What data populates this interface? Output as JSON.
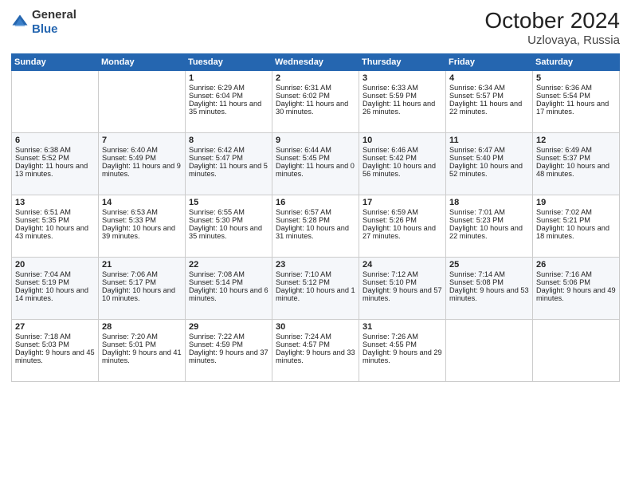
{
  "header": {
    "logo_general": "General",
    "logo_blue": "Blue",
    "month": "October 2024",
    "location": "Uzlovaya, Russia"
  },
  "days_of_week": [
    "Sunday",
    "Monday",
    "Tuesday",
    "Wednesday",
    "Thursday",
    "Friday",
    "Saturday"
  ],
  "weeks": [
    [
      {
        "day": "",
        "sunrise": "",
        "sunset": "",
        "daylight": ""
      },
      {
        "day": "",
        "sunrise": "",
        "sunset": "",
        "daylight": ""
      },
      {
        "day": "1",
        "sunrise": "Sunrise: 6:29 AM",
        "sunset": "Sunset: 6:04 PM",
        "daylight": "Daylight: 11 hours and 35 minutes."
      },
      {
        "day": "2",
        "sunrise": "Sunrise: 6:31 AM",
        "sunset": "Sunset: 6:02 PM",
        "daylight": "Daylight: 11 hours and 30 minutes."
      },
      {
        "day": "3",
        "sunrise": "Sunrise: 6:33 AM",
        "sunset": "Sunset: 5:59 PM",
        "daylight": "Daylight: 11 hours and 26 minutes."
      },
      {
        "day": "4",
        "sunrise": "Sunrise: 6:34 AM",
        "sunset": "Sunset: 5:57 PM",
        "daylight": "Daylight: 11 hours and 22 minutes."
      },
      {
        "day": "5",
        "sunrise": "Sunrise: 6:36 AM",
        "sunset": "Sunset: 5:54 PM",
        "daylight": "Daylight: 11 hours and 17 minutes."
      }
    ],
    [
      {
        "day": "6",
        "sunrise": "Sunrise: 6:38 AM",
        "sunset": "Sunset: 5:52 PM",
        "daylight": "Daylight: 11 hours and 13 minutes."
      },
      {
        "day": "7",
        "sunrise": "Sunrise: 6:40 AM",
        "sunset": "Sunset: 5:49 PM",
        "daylight": "Daylight: 11 hours and 9 minutes."
      },
      {
        "day": "8",
        "sunrise": "Sunrise: 6:42 AM",
        "sunset": "Sunset: 5:47 PM",
        "daylight": "Daylight: 11 hours and 5 minutes."
      },
      {
        "day": "9",
        "sunrise": "Sunrise: 6:44 AM",
        "sunset": "Sunset: 5:45 PM",
        "daylight": "Daylight: 11 hours and 0 minutes."
      },
      {
        "day": "10",
        "sunrise": "Sunrise: 6:46 AM",
        "sunset": "Sunset: 5:42 PM",
        "daylight": "Daylight: 10 hours and 56 minutes."
      },
      {
        "day": "11",
        "sunrise": "Sunrise: 6:47 AM",
        "sunset": "Sunset: 5:40 PM",
        "daylight": "Daylight: 10 hours and 52 minutes."
      },
      {
        "day": "12",
        "sunrise": "Sunrise: 6:49 AM",
        "sunset": "Sunset: 5:37 PM",
        "daylight": "Daylight: 10 hours and 48 minutes."
      }
    ],
    [
      {
        "day": "13",
        "sunrise": "Sunrise: 6:51 AM",
        "sunset": "Sunset: 5:35 PM",
        "daylight": "Daylight: 10 hours and 43 minutes."
      },
      {
        "day": "14",
        "sunrise": "Sunrise: 6:53 AM",
        "sunset": "Sunset: 5:33 PM",
        "daylight": "Daylight: 10 hours and 39 minutes."
      },
      {
        "day": "15",
        "sunrise": "Sunrise: 6:55 AM",
        "sunset": "Sunset: 5:30 PM",
        "daylight": "Daylight: 10 hours and 35 minutes."
      },
      {
        "day": "16",
        "sunrise": "Sunrise: 6:57 AM",
        "sunset": "Sunset: 5:28 PM",
        "daylight": "Daylight: 10 hours and 31 minutes."
      },
      {
        "day": "17",
        "sunrise": "Sunrise: 6:59 AM",
        "sunset": "Sunset: 5:26 PM",
        "daylight": "Daylight: 10 hours and 27 minutes."
      },
      {
        "day": "18",
        "sunrise": "Sunrise: 7:01 AM",
        "sunset": "Sunset: 5:23 PM",
        "daylight": "Daylight: 10 hours and 22 minutes."
      },
      {
        "day": "19",
        "sunrise": "Sunrise: 7:02 AM",
        "sunset": "Sunset: 5:21 PM",
        "daylight": "Daylight: 10 hours and 18 minutes."
      }
    ],
    [
      {
        "day": "20",
        "sunrise": "Sunrise: 7:04 AM",
        "sunset": "Sunset: 5:19 PM",
        "daylight": "Daylight: 10 hours and 14 minutes."
      },
      {
        "day": "21",
        "sunrise": "Sunrise: 7:06 AM",
        "sunset": "Sunset: 5:17 PM",
        "daylight": "Daylight: 10 hours and 10 minutes."
      },
      {
        "day": "22",
        "sunrise": "Sunrise: 7:08 AM",
        "sunset": "Sunset: 5:14 PM",
        "daylight": "Daylight: 10 hours and 6 minutes."
      },
      {
        "day": "23",
        "sunrise": "Sunrise: 7:10 AM",
        "sunset": "Sunset: 5:12 PM",
        "daylight": "Daylight: 10 hours and 1 minute."
      },
      {
        "day": "24",
        "sunrise": "Sunrise: 7:12 AM",
        "sunset": "Sunset: 5:10 PM",
        "daylight": "Daylight: 9 hours and 57 minutes."
      },
      {
        "day": "25",
        "sunrise": "Sunrise: 7:14 AM",
        "sunset": "Sunset: 5:08 PM",
        "daylight": "Daylight: 9 hours and 53 minutes."
      },
      {
        "day": "26",
        "sunrise": "Sunrise: 7:16 AM",
        "sunset": "Sunset: 5:06 PM",
        "daylight": "Daylight: 9 hours and 49 minutes."
      }
    ],
    [
      {
        "day": "27",
        "sunrise": "Sunrise: 7:18 AM",
        "sunset": "Sunset: 5:03 PM",
        "daylight": "Daylight: 9 hours and 45 minutes."
      },
      {
        "day": "28",
        "sunrise": "Sunrise: 7:20 AM",
        "sunset": "Sunset: 5:01 PM",
        "daylight": "Daylight: 9 hours and 41 minutes."
      },
      {
        "day": "29",
        "sunrise": "Sunrise: 7:22 AM",
        "sunset": "Sunset: 4:59 PM",
        "daylight": "Daylight: 9 hours and 37 minutes."
      },
      {
        "day": "30",
        "sunrise": "Sunrise: 7:24 AM",
        "sunset": "Sunset: 4:57 PM",
        "daylight": "Daylight: 9 hours and 33 minutes."
      },
      {
        "day": "31",
        "sunrise": "Sunrise: 7:26 AM",
        "sunset": "Sunset: 4:55 PM",
        "daylight": "Daylight: 9 hours and 29 minutes."
      },
      {
        "day": "",
        "sunrise": "",
        "sunset": "",
        "daylight": ""
      },
      {
        "day": "",
        "sunrise": "",
        "sunset": "",
        "daylight": ""
      }
    ]
  ]
}
